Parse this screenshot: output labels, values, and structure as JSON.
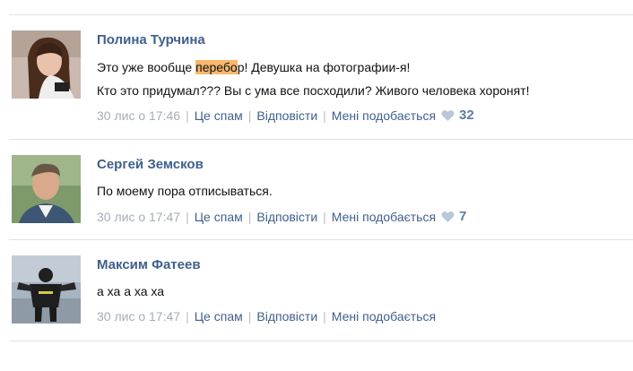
{
  "comments": [
    {
      "author": "Полина Турчина",
      "line1_before": "Это уже вообще ",
      "line1_highlight": "перебо",
      "line1_after": "р! Девушка на фотографии-я!",
      "line2": "Кто это придумал??? Вы с ума все посходили? Живого человека хоронят!",
      "date": "30 лис о 17:46",
      "spam_label": "Це спам",
      "reply_label": "Відповісти",
      "like_label": "Мені подобається",
      "likes": "32"
    },
    {
      "author": "Сергей Земсков",
      "line1": "По моему пора отписываться.",
      "date": "30 лис о 17:47",
      "spam_label": "Це спам",
      "reply_label": "Відповісти",
      "like_label": "Мені подобається",
      "likes": "7"
    },
    {
      "author": "Максим Фатеев",
      "line1": "а ха а ха ха",
      "date": "30 лис о 17:47",
      "spam_label": "Це спам",
      "reply_label": "Відповісти",
      "like_label": "Мені подобається"
    }
  ],
  "separator": "|",
  "colors": {
    "author": "#3f5f8c",
    "link": "#3f5f8c",
    "meta": "#a5adb8",
    "highlight": "#f7b76e",
    "divider": "#dfe3e8"
  }
}
